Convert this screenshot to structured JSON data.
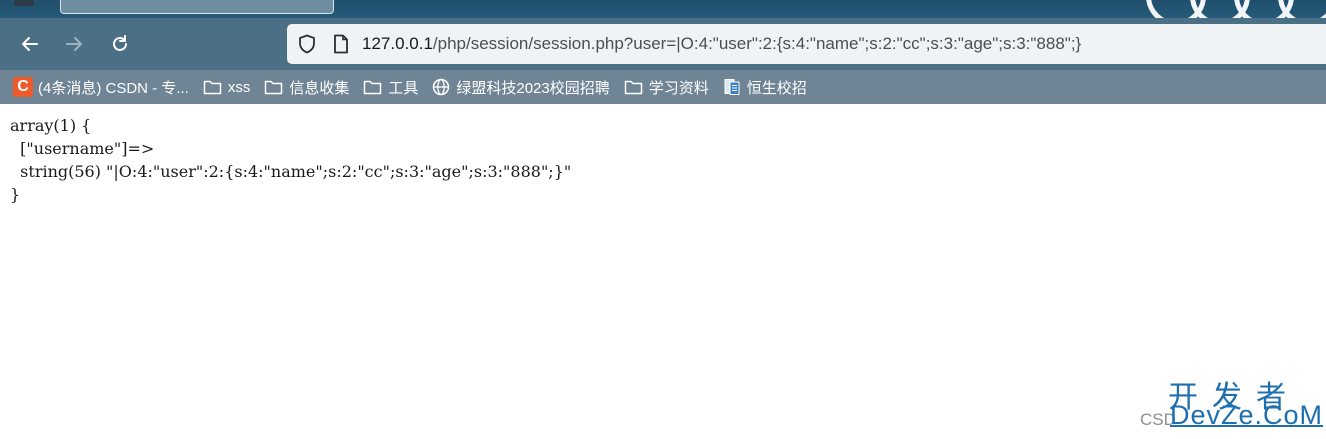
{
  "browser": {
    "url": {
      "host": "127.0.0.1",
      "path": "/php/session/session.php?user=|O:4:\"user\":2:{s:4:\"name\";s:2:\"cc\";s:3:\"age\";s:3:\"888\";}"
    },
    "icons": {
      "back": "arrow-left-icon",
      "forward": "arrow-right-icon",
      "reload": "reload-icon",
      "shield": "shield-icon",
      "page": "page-icon"
    }
  },
  "bookmarks": [
    {
      "label": "(4条消息) CSDN - 专...",
      "icon": "csdn-icon"
    },
    {
      "label": "xss",
      "icon": "folder-icon"
    },
    {
      "label": "信息收集",
      "icon": "folder-icon"
    },
    {
      "label": "工具",
      "icon": "folder-icon"
    },
    {
      "label": "绿盟科技2023校园招聘",
      "icon": "globe-icon"
    },
    {
      "label": "学习资料",
      "icon": "folder-icon"
    },
    {
      "label": "恒生校招",
      "icon": "document-icon"
    }
  ],
  "csdn_badge": "C",
  "page": {
    "lines": [
      "array(1) {",
      "  [\"username\"]=>",
      "  string(56) \"|O:4:\"user\":2:{s:4:\"name\";s:2:\"cc\";s:3:\"age\";s:3:\"888\";}\"",
      "}"
    ]
  },
  "watermark": {
    "cn": "开发者",
    "en": "DevZe.CoM",
    "left": "CSD"
  },
  "colors": {
    "tabstrip": "#255a78",
    "toolbar": "#4b6f85",
    "bookmarks_bar": "#6f8595",
    "csdn_orange": "#f05a2a",
    "watermark_blue": "#1f6fae"
  }
}
